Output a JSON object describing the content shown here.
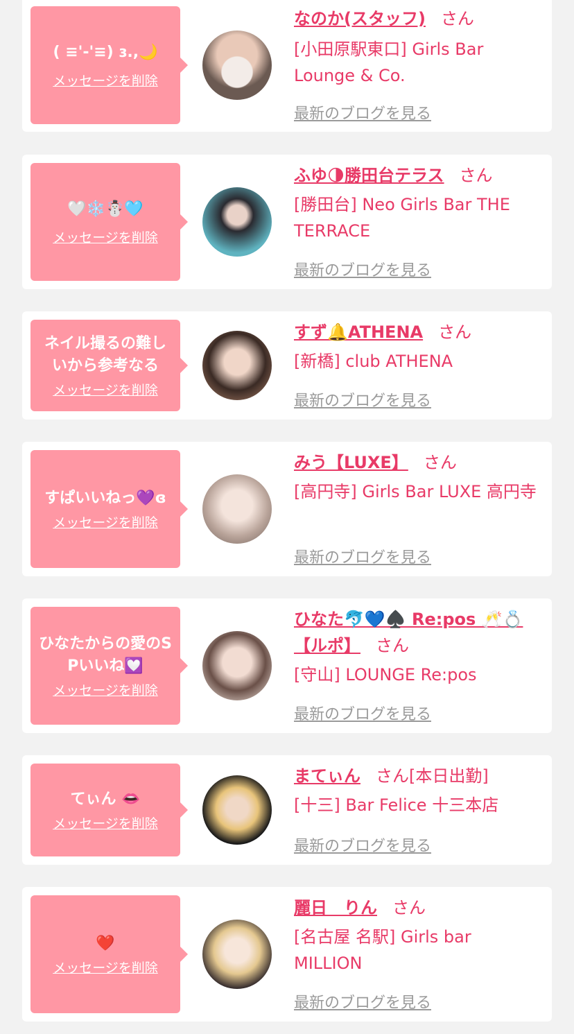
{
  "delete_label": "メッセージを削除",
  "blog_label": "最新のブログを見る",
  "colors": {
    "bubble": "#ff97a4",
    "name": "#e83a67",
    "background": "#f2f2f2",
    "link_gray": "#9a9a9a"
  },
  "items": [
    {
      "message": "( ≡'-'≡) ɜ.,🌙",
      "name": "なのか(スタッフ)",
      "honorific": "さん",
      "extra": "",
      "shop": "[小田原駅東口] Girls Bar Lounge & Co."
    },
    {
      "message": "🤍❄️☃️🩵",
      "name": "ふゆ🌗勝田台テラス",
      "honorific": "さん",
      "extra": "",
      "shop": "[勝田台] Neo Girls Bar THE TERRACE"
    },
    {
      "message": "ネイル撮るの難しいから参考なる",
      "name": "すず🔔ATHENA",
      "honorific": "さん",
      "extra": "",
      "shop": "[新橋] club ATHENA"
    },
    {
      "message": "すぱいいねっ💜ɞ",
      "name": "みう【LUXE】",
      "honorific": "さん",
      "extra": "",
      "shop": "[高円寺] Girls Bar LUXE 高円寺"
    },
    {
      "message": "ひなたからの愛のSPいいね💟",
      "name": "ひなた🐬💙♠️ Re:pos 🥂💍【ルポ】",
      "honorific": "さん",
      "extra": "",
      "shop": "[守山] LOUNGE Re:pos"
    },
    {
      "message": "てぃん 👄",
      "name": "まてぃん",
      "honorific": "さん",
      "extra": "[本日出勤]",
      "shop": "[十三] Bar Felice 十三本店"
    },
    {
      "message": "❤️",
      "name": "麗日　りん",
      "honorific": "さん",
      "extra": "",
      "shop": "[名古屋 名駅] Girls bar MILLION"
    }
  ]
}
